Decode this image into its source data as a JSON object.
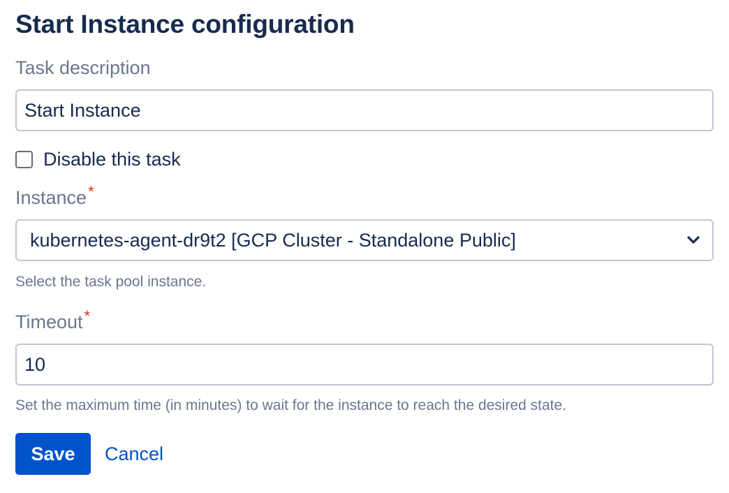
{
  "page": {
    "title": "Start Instance configuration"
  },
  "form": {
    "task_description": {
      "label": "Task description",
      "value": "Start Instance"
    },
    "disable_task": {
      "label": "Disable this task",
      "checked": false
    },
    "instance": {
      "label": "Instance",
      "required_marker": "*",
      "selected": "kubernetes-agent-dr9t2 [GCP Cluster - Standalone Public]",
      "help": "Select the task pool instance."
    },
    "timeout": {
      "label": "Timeout",
      "required_marker": "*",
      "value": "10",
      "help": "Set the maximum time (in minutes) to wait for the instance to reach the desired state."
    }
  },
  "actions": {
    "save_label": "Save",
    "cancel_label": "Cancel"
  },
  "colors": {
    "primary": "#0052cc",
    "text": "#172b4d",
    "muted": "#6b778c",
    "required": "#de350b",
    "border": "#c1c7d0"
  }
}
